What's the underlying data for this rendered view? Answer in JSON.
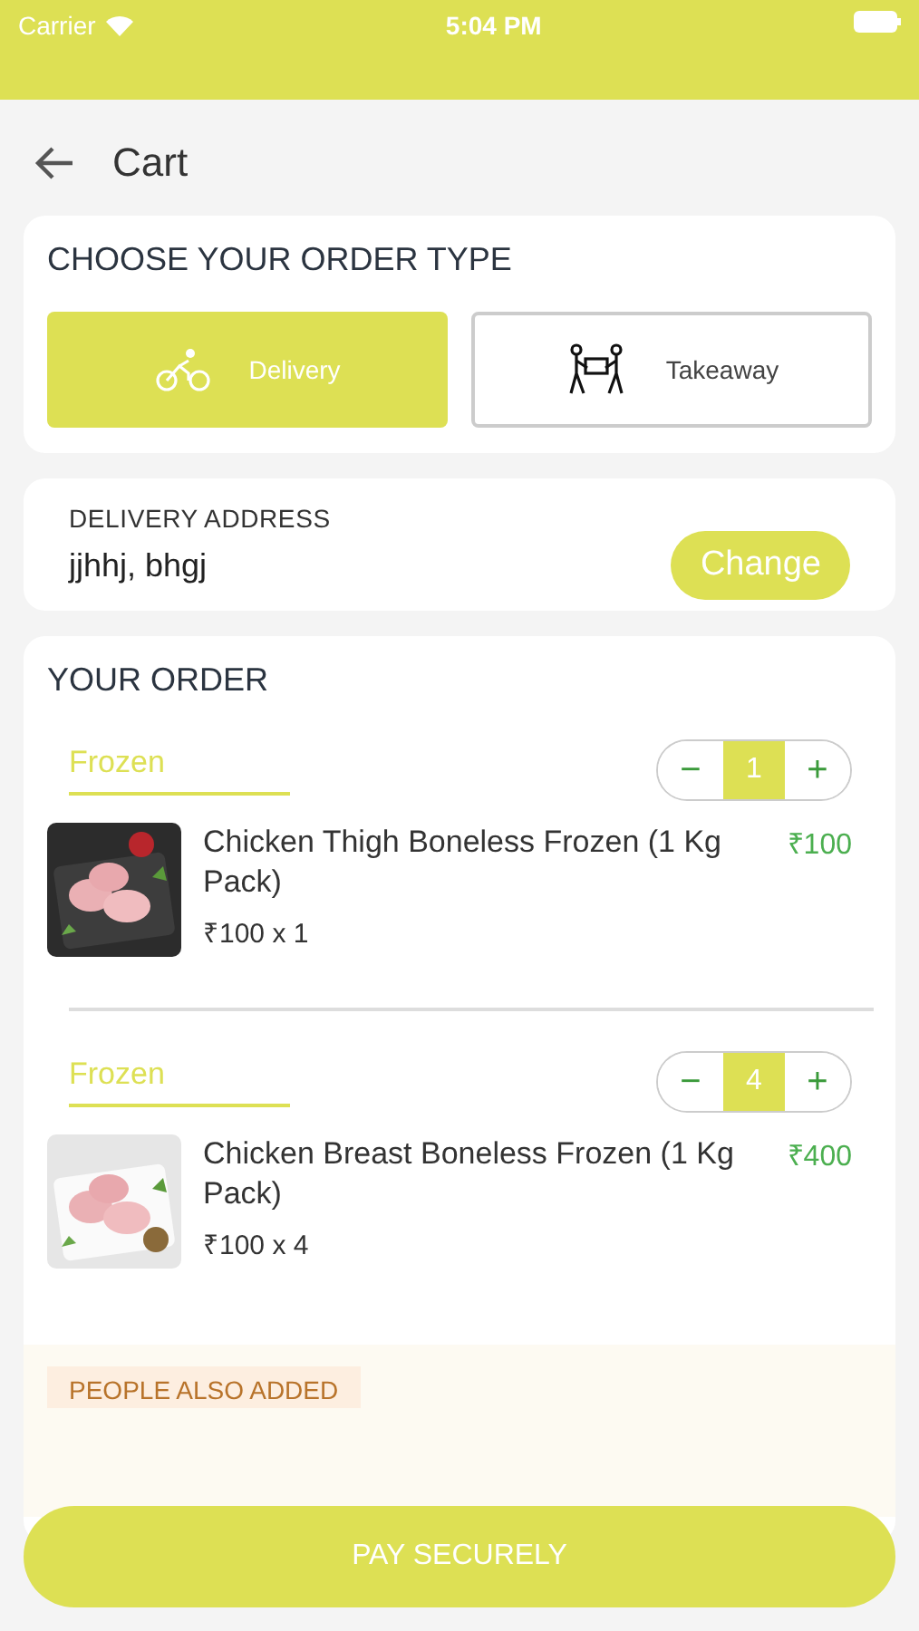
{
  "status_bar": {
    "carrier": "Carrier",
    "time": "5:04 PM"
  },
  "header": {
    "title": "Cart"
  },
  "order_type": {
    "title": "CHOOSE YOUR ORDER TYPE",
    "options": [
      {
        "kind": "delivery",
        "label": "Delivery",
        "selected": true
      },
      {
        "kind": "takeaway",
        "label": "Takeaway",
        "selected": false
      }
    ]
  },
  "address": {
    "label": "DELIVERY ADDRESS",
    "value": "jjhhj, bhgj",
    "button": "Change"
  },
  "order": {
    "title": "YOUR ORDER",
    "items": [
      {
        "category": "Frozen",
        "quantity": "1",
        "name": "Chicken Thigh Boneless Frozen (1 Kg Pack)",
        "unit": "₹100 x 1",
        "price": "₹100",
        "minus": "−",
        "plus": "+"
      },
      {
        "category": "Frozen",
        "quantity": "4",
        "name": "Chicken Breast Boneless Frozen (1 Kg Pack)",
        "unit": "₹100 x 4",
        "price": "₹400",
        "minus": "−",
        "plus": "+"
      }
    ]
  },
  "suggestions": {
    "title": "PEOPLE ALSO ADDED"
  },
  "pay_button": "PAY SECURELY"
}
